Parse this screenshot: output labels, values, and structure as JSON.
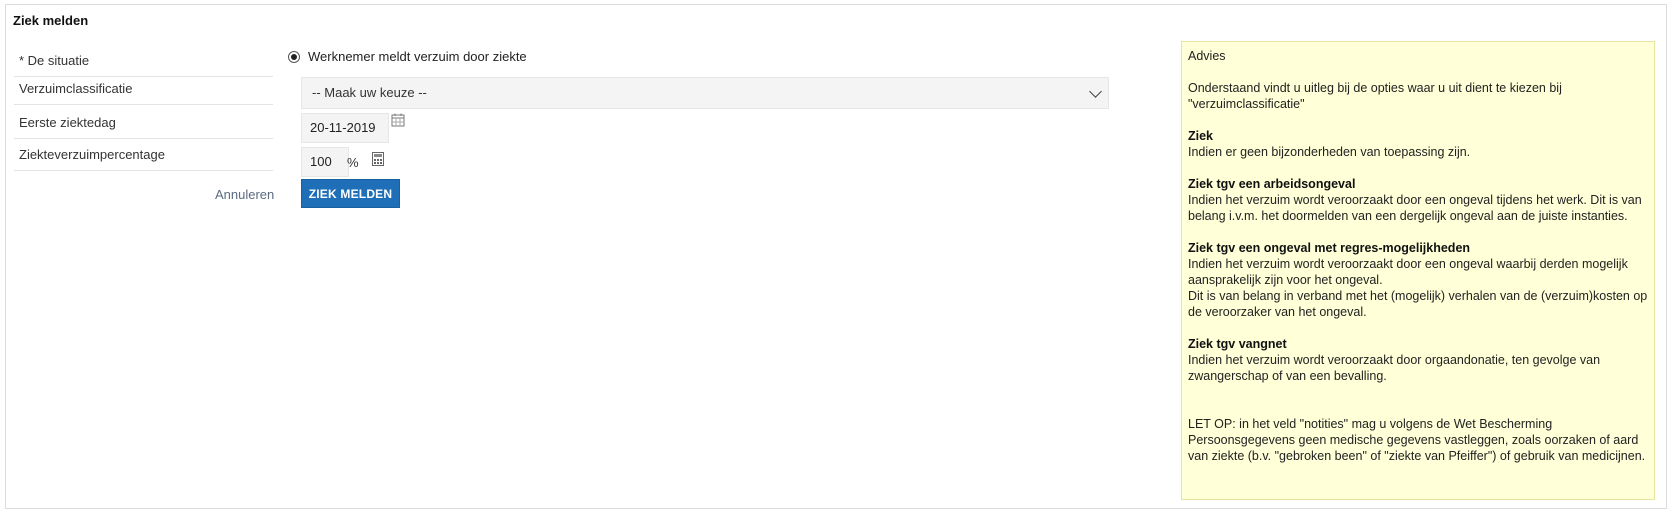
{
  "form": {
    "title": "Ziek melden",
    "labels": {
      "situatie": "* De situatie",
      "classificatie": "Verzuimclassificatie",
      "ziektedag": "Eerste ziektedag",
      "percentage": "Ziekteverzuimpercentage"
    },
    "situatie_option": "Werknemer meldt verzuim door ziekte",
    "classificatie_value": "-- Maak uw keuze --",
    "ziektedag_value": "20-11-2019",
    "percentage_value": "100",
    "percentage_unit": "%",
    "cancel_label": "Annuleren",
    "submit_label": "ZIEK MELDEN"
  },
  "advice": {
    "heading": "Advies",
    "intro": "Onderstaand vindt u uitleg bij de opties waar u uit dient te kiezen bij \"verzuimclassificatie\"",
    "items": [
      {
        "title": "Ziek",
        "text": "Indien er geen bijzonderheden van toepassing zijn."
      },
      {
        "title": "Ziek tgv een arbeidsongeval",
        "text": "Indien het verzuim wordt veroorzaakt door een ongeval tijdens het werk. Dit is van belang i.v.m. het doormelden van een dergelijk ongeval aan de juiste instanties."
      },
      {
        "title": "Ziek tgv een ongeval met regres-mogelijkheden",
        "text": "Indien het verzuim wordt veroorzaakt door een ongeval waarbij derden mogelijk aansprakelijk zijn voor het ongeval.",
        "text2": "Dit is van belang in verband met het (mogelijk) verhalen van de (verzuim)kosten op de veroorzaker van het ongeval."
      },
      {
        "title": "Ziek tgv vangnet",
        "text": "Indien het verzuim wordt veroorzaakt door orgaandonatie, ten gevolge van zwangerschap of van een bevalling."
      }
    ],
    "note": "LET OP: in het veld \"notities\" mag u volgens de Wet Bescherming Persoonsgegevens geen medische gegevens vastleggen, zoals oorzaken of aard van ziekte (b.v. \"gebroken been\" of \"ziekte van Pfeiffer\") of gebruik van medicijnen."
  },
  "colors": {
    "primary_button": "#1e6fb8",
    "advice_background": "#ffffd8"
  },
  "icons": [
    "calendar-icon",
    "calculator-icon",
    "chevron-down-icon"
  ]
}
